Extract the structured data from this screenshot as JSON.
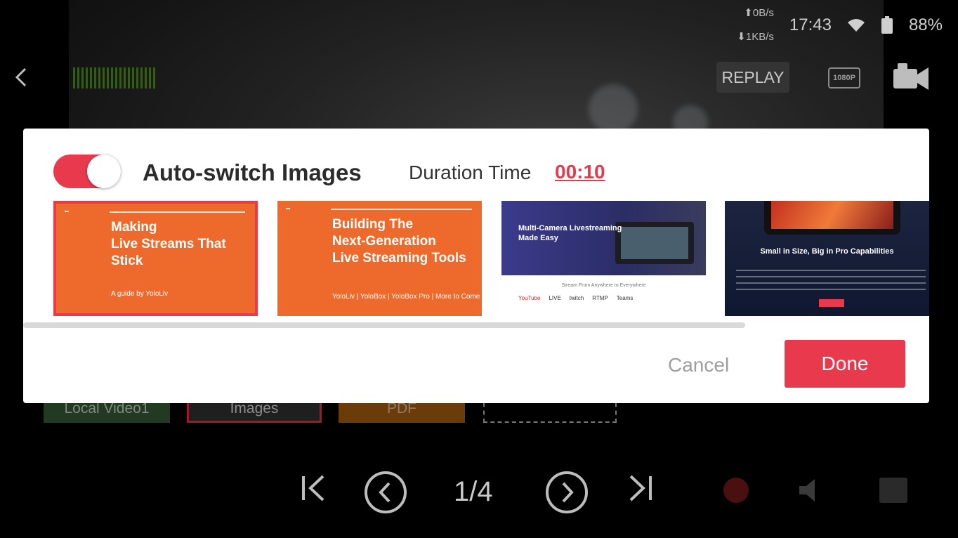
{
  "status_bar": {
    "upload": "⬆0B/s",
    "download": "⬇1KB/s",
    "time": "17:43",
    "battery": "88%"
  },
  "toolbar": {
    "replay_label": "REPLAY",
    "resolution": "1080P"
  },
  "sources": {
    "local_video": "Local Video1",
    "images": "Images",
    "pdf": "PDF"
  },
  "controls": {
    "page_indicator": "1/4"
  },
  "dialog": {
    "toggle_on": true,
    "title": "Auto-switch Images",
    "duration_label": "Duration Time",
    "duration_value": "00:10",
    "thumbnails": [
      {
        "heading": "Making\nLive Streams That\nStick",
        "footer": "A guide by YoloLiv",
        "selected": true
      },
      {
        "heading": "Building The\nNext-Generation\nLive Streaming Tools",
        "footer": "YoloLiv | YoloBox | YoloBox Pro | More to Come",
        "selected": false
      },
      {
        "heading": "Multi-Camera Livestreaming\nMade Easy",
        "subtitle": "Stream From Anywhere to Everywhere",
        "logos": [
          "YouTube",
          "LIVE",
          "twitch",
          "RTMP",
          "Teams"
        ],
        "selected": false
      },
      {
        "heading": "Small in Size, Big in Pro Capabilities",
        "selected": false
      }
    ],
    "cancel_label": "Cancel",
    "done_label": "Done"
  },
  "colors": {
    "accent": "#e8394d",
    "slide_orange": "#ee6a2c"
  }
}
